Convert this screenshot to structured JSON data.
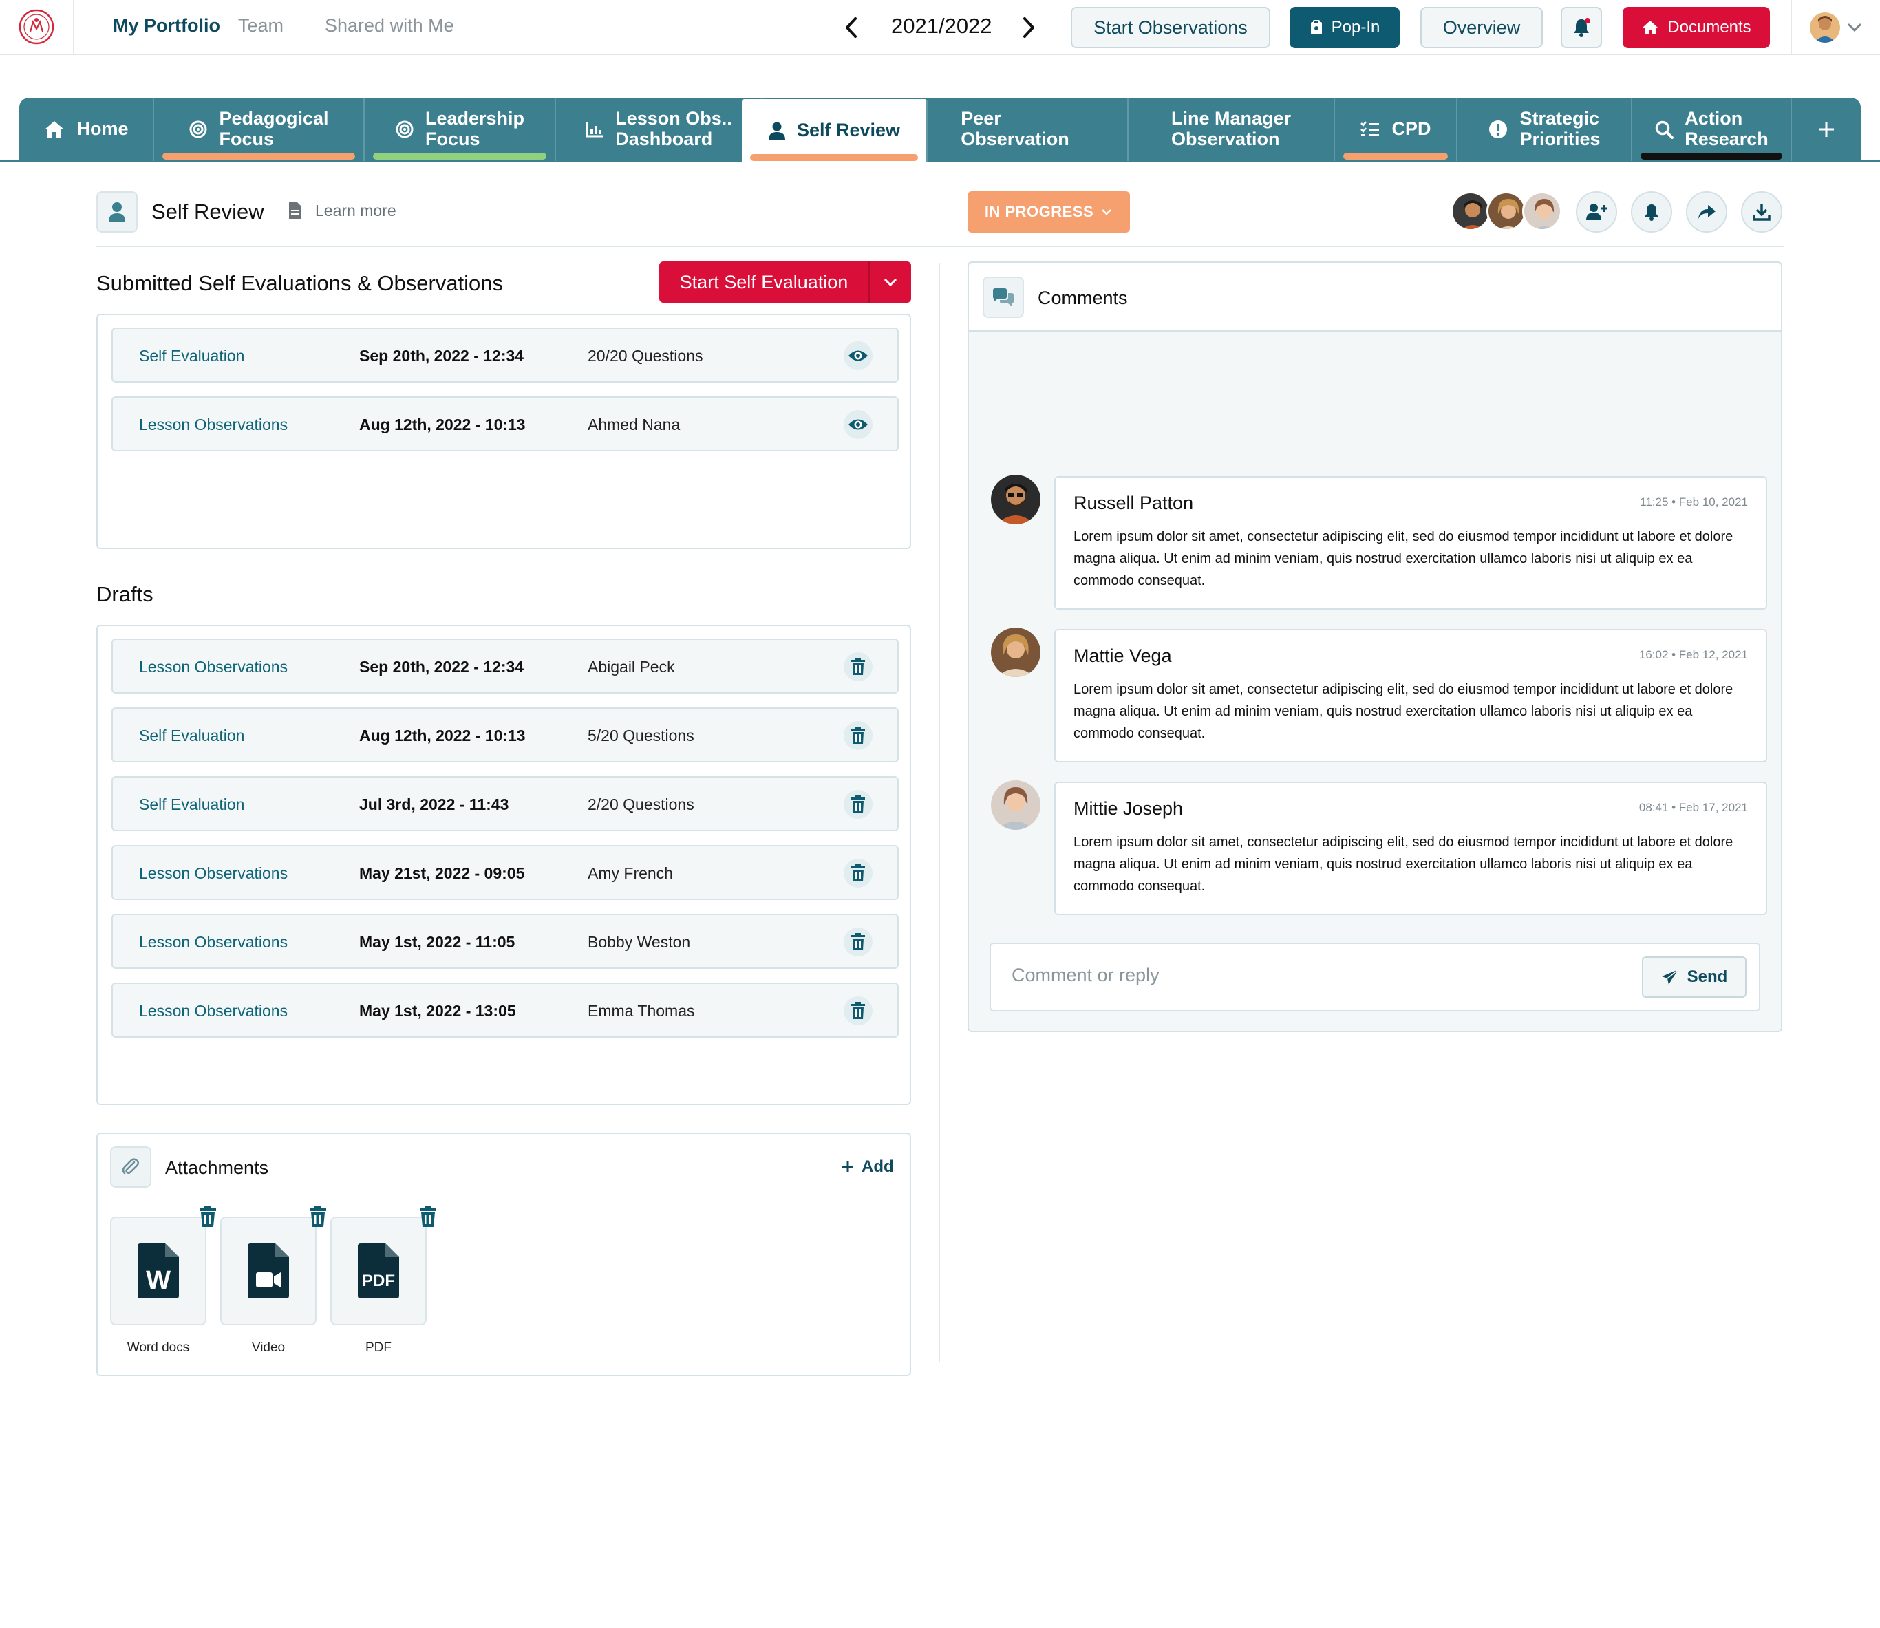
{
  "topbar": {
    "nav": [
      "My Portfolio",
      "Team",
      "Shared with Me"
    ],
    "year": "2021/2022",
    "start_observations": "Start Observations",
    "pop_in": "Pop-In",
    "overview": "Overview",
    "documents": "Documents"
  },
  "tabs": [
    {
      "label": "Home",
      "icon": "home-icon"
    },
    {
      "label": "Pedagogical\nFocus",
      "icon": "target-icon",
      "indicator": "#f6a070"
    },
    {
      "label": "Leadership\nFocus",
      "icon": "target-icon",
      "indicator": "#8fd17f"
    },
    {
      "label": "Lesson Obs..\nDashboard",
      "icon": "chart-icon"
    },
    {
      "label": "Self Review",
      "icon": "user-icon",
      "indicator": "#f6a070",
      "active": true
    },
    {
      "label": "Peer\nObservation"
    },
    {
      "label": "Line Manager\nObservation"
    },
    {
      "label": "CPD",
      "icon": "checklist-icon",
      "indicator": "#f6a070"
    },
    {
      "label": "Strategic\nPriorities",
      "icon": "exclamation-icon"
    },
    {
      "label": "Action\nResearch",
      "icon": "search-icon",
      "indicator": "#111111"
    }
  ],
  "header": {
    "title": "Self Review",
    "learn_more": "Learn more",
    "status": "IN PROGRESS"
  },
  "submitted": {
    "title": "Submitted Self Evaluations & Observations",
    "start_button": "Start Self Evaluation",
    "rows": [
      {
        "type": "Self Evaluation",
        "date": "Sep 20th, 2022 - 12:34",
        "detail": "20/20 Questions"
      },
      {
        "type": "Lesson Observations",
        "date": "Aug 12th, 2022 - 10:13",
        "detail": "Ahmed Nana"
      }
    ]
  },
  "drafts": {
    "title": "Drafts",
    "rows": [
      {
        "type": "Lesson Observations",
        "date": "Sep 20th, 2022 - 12:34",
        "detail": "Abigail Peck"
      },
      {
        "type": "Self Evaluation",
        "date": "Aug 12th, 2022 - 10:13",
        "detail": "5/20 Questions"
      },
      {
        "type": "Self Evaluation",
        "date": "Jul 3rd, 2022 - 11:43",
        "detail": "2/20 Questions"
      },
      {
        "type": "Lesson Observations",
        "date": "May 21st, 2022 - 09:05",
        "detail": "Amy French"
      },
      {
        "type": "Lesson Observations",
        "date": "May 1st, 2022 - 11:05",
        "detail": "Bobby Weston"
      },
      {
        "type": "Lesson Observations",
        "date": "May 1st, 2022 - 13:05",
        "detail": "Emma Thomas"
      }
    ]
  },
  "attachments": {
    "title": "Attachments",
    "add": "Add",
    "files": [
      {
        "label": "Word docs",
        "icon": "word-file-icon"
      },
      {
        "label": "Video",
        "icon": "video-file-icon"
      },
      {
        "label": "PDF",
        "icon": "pdf-file-icon"
      }
    ]
  },
  "comments": {
    "title": "Comments",
    "items": [
      {
        "name": "Russell Patton",
        "time": "11:25 • Feb 10, 2021",
        "text": "Lorem ipsum dolor sit amet, consectetur adipiscing elit, sed do eiusmod tempor incididunt ut labore et dolore magna aliqua. Ut enim ad minim veniam, quis nostrud exercitation ullamco laboris nisi ut aliquip ex ea commodo consequat."
      },
      {
        "name": "Mattie Vega",
        "time": "16:02 • Feb 12, 2021",
        "text": "Lorem ipsum dolor sit amet, consectetur adipiscing elit, sed do eiusmod tempor incididunt ut labore et dolore magna aliqua. Ut enim ad minim veniam, quis nostrud exercitation ullamco laboris nisi ut aliquip ex ea commodo consequat."
      },
      {
        "name": "Mittie Joseph",
        "time": "08:41 • Feb 17, 2021",
        "text": "Lorem ipsum dolor sit amet, consectetur adipiscing elit, sed do eiusmod tempor incididunt ut labore et dolore magna aliqua. Ut enim ad minim veniam, quis nostrud exercitation ullamco laboris nisi ut aliquip ex ea commodo consequat."
      }
    ],
    "reply_placeholder": "Comment or reply",
    "send": "Send"
  },
  "colors": {
    "teal": "#3c7f8f",
    "dark_teal": "#0e5a70",
    "red": "#d90f3a",
    "orange": "#f6a070"
  }
}
